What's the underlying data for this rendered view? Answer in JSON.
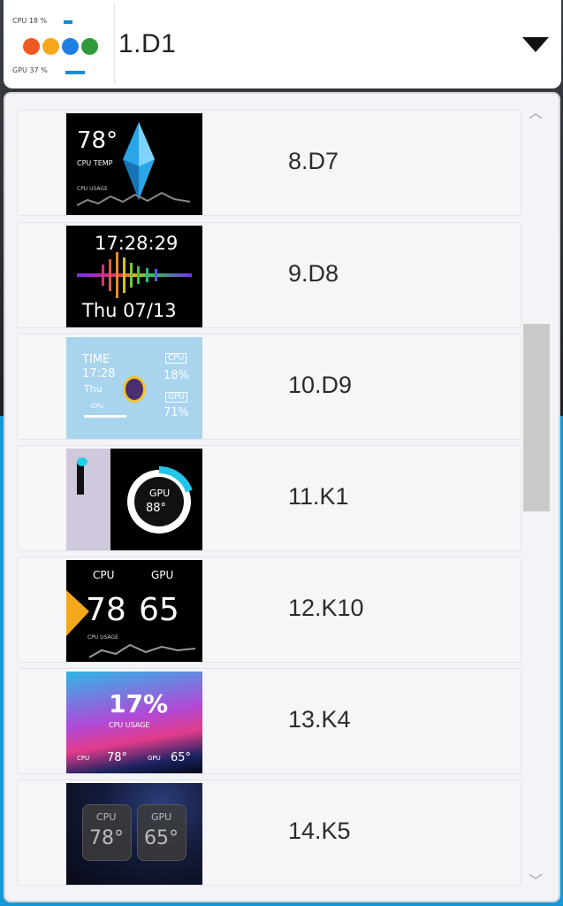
{
  "selected": {
    "label": "1.D1",
    "thumb": {
      "line1": "CPU 18 %",
      "line2": "GPU 37 %"
    }
  },
  "items": [
    {
      "label": "8.D7",
      "thumb": {
        "temp": "78°",
        "sub": "CPU TEMP",
        "small": "CPU USAGE"
      }
    },
    {
      "label": "9.D8",
      "thumb": {
        "time": "17:28:29",
        "date": "Thu  07/13"
      }
    },
    {
      "label": "10.D9",
      "thumb": {
        "l1": "TIME",
        "l2": "17:28",
        "l3": "Thu",
        "l4": "CPU",
        "r1": "CPU",
        "r2": "18%",
        "r3": "GPU",
        "r4": "71%"
      }
    },
    {
      "label": "11.K1",
      "thumb": {
        "ring1": "GPU",
        "ring2": "88°"
      }
    },
    {
      "label": "12.K10",
      "thumb": {
        "a": "CPU",
        "b": "GPU",
        "v1": "78",
        "v2": "65",
        "small": "CPU USAGE"
      }
    },
    {
      "label": "13.K4",
      "thumb": {
        "big": "17%",
        "sub": "CPU USAGE",
        "t1": "CPU",
        "v1": "78°",
        "t2": "GPU",
        "v2": "65°"
      }
    },
    {
      "label": "14.K5",
      "thumb": {
        "c1": "CPU",
        "v1": "78°",
        "c2": "GPU",
        "v2": "65°"
      }
    }
  ],
  "colors": {
    "faces": [
      "#ef5a24",
      "#f7a71b",
      "#1f7fe0",
      "#2e9a3a"
    ],
    "accent_blue": "#1798d6"
  }
}
